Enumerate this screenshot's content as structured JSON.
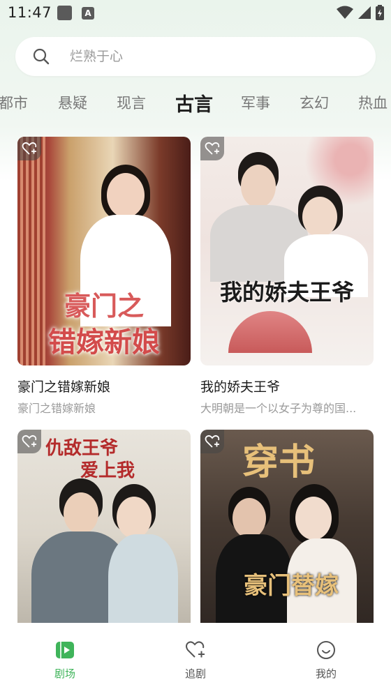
{
  "status_bar": {
    "time": "11:47",
    "app_badge": "A"
  },
  "search": {
    "placeholder": "烂熟于心"
  },
  "tabs": [
    {
      "label": "都市"
    },
    {
      "label": "悬疑"
    },
    {
      "label": "现言"
    },
    {
      "label": "古言",
      "active": true
    },
    {
      "label": "军事"
    },
    {
      "label": "玄幻"
    },
    {
      "label": "热血"
    }
  ],
  "cards": [
    {
      "title": "豪门之错嫁新娘",
      "desc": "豪门之错嫁新娘",
      "poster_line1": "豪门之",
      "poster_line2": "错嫁新娘"
    },
    {
      "title": "我的娇夫王爷",
      "desc": "大明朝是一个以女子为尊的国...",
      "poster_line1": "我的娇夫王爷"
    },
    {
      "poster_line1": "仇敌王爷",
      "poster_line2": "爱上我"
    },
    {
      "poster_line1": "穿书",
      "poster_line2": "豪门替嫁"
    }
  ],
  "bottom_nav": [
    {
      "label": "剧场",
      "icon": "theater-icon",
      "active": true
    },
    {
      "label": "追剧",
      "icon": "heart-plus-icon"
    },
    {
      "label": "我的",
      "icon": "profile-smile-icon"
    }
  ],
  "colors": {
    "accent": "#3fb45a",
    "tab_active": "#1c1c1c",
    "tab_inactive": "#777777"
  }
}
